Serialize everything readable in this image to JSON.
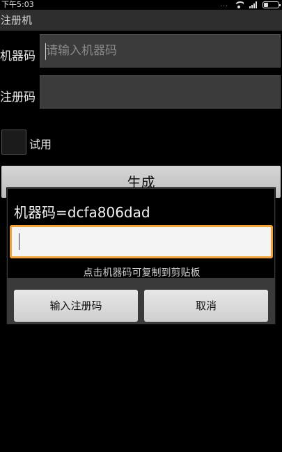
{
  "status_bar": {
    "time": "下午5:03",
    "dots": "..."
  },
  "app": {
    "title": "注册机"
  },
  "form": {
    "machine_code_label": "机器码",
    "machine_code_placeholder": "请输入机器码",
    "register_code_label": "注册码",
    "trial_label": "试用",
    "generate_label": "生成"
  },
  "dialog": {
    "title": "机器码=dcfa806dad",
    "hint": "点击机器码可复制到剪贴板",
    "confirm_label": "输入注册码",
    "cancel_label": "取消"
  },
  "colors": {
    "input_focus": "#f0a13a",
    "title_bar": "#2e2e2e",
    "field_bg": "#3b3b3b"
  }
}
